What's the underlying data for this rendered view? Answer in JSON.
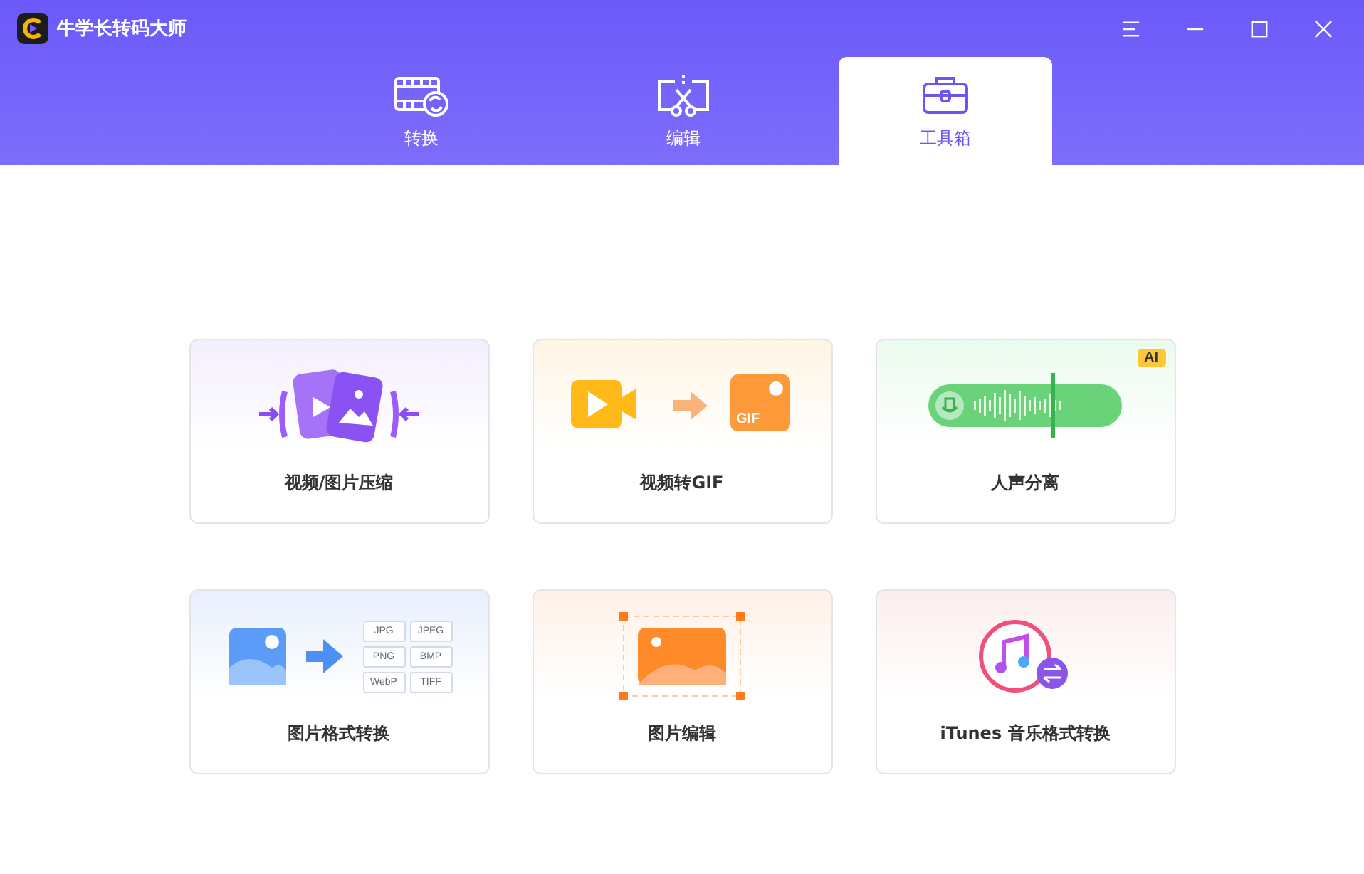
{
  "window": {
    "title": "牛学长转码大师"
  },
  "tabs": [
    {
      "label": "转换",
      "selected": false,
      "kind": "convert"
    },
    {
      "label": "编辑",
      "selected": false,
      "kind": "edit"
    },
    {
      "label": "工具箱",
      "selected": true,
      "kind": "toolbox"
    }
  ],
  "tools": [
    {
      "kind": "compress",
      "label": "视频/图片压缩"
    },
    {
      "kind": "gif",
      "label": "视频转GIF",
      "icon_text": "GIF"
    },
    {
      "kind": "voice",
      "label": "人声分离",
      "badge": "AI"
    },
    {
      "kind": "format",
      "label": "图片格式转换",
      "formats": [
        "JPG",
        "JPEG",
        "PNG",
        "BMP",
        "WebP",
        "TIFF"
      ]
    },
    {
      "kind": "edit",
      "label": "图片编辑"
    },
    {
      "kind": "itunes",
      "label": "iTunes 音乐格式转换"
    }
  ]
}
